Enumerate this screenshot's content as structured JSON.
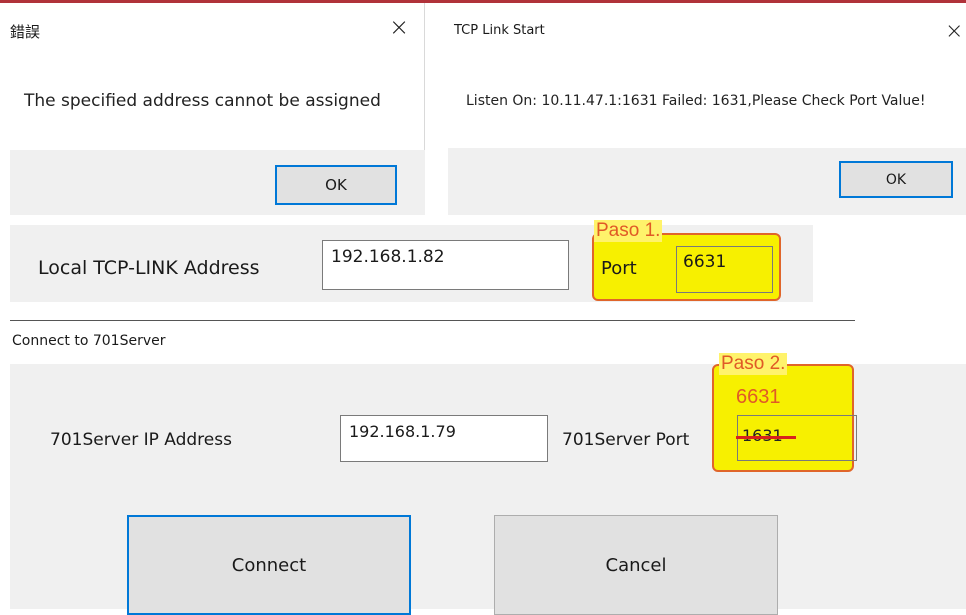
{
  "error_dialog": {
    "title": "錯誤",
    "message": "The specified address cannot be assigned",
    "ok_label": "OK",
    "close_icon": "×"
  },
  "tcp_dialog": {
    "title": "TCP Link Start",
    "message": "Listen On: 10.11.47.1:1631 Failed: 1631,Please Check Port Value!",
    "ok_label": "OK",
    "close_icon": "×"
  },
  "local": {
    "label": "Local TCP-LINK Address",
    "ip_value": "192.168.1.82",
    "port_label": "Port",
    "port_value": "6631",
    "step_label": "Paso 1."
  },
  "connect": {
    "title": "Connect to 701Server",
    "ip_label": "701Server IP Address",
    "ip_value": "192.168.1.79",
    "port_label": "701Server Port",
    "old_port_value": "1631",
    "new_port_value": "6631",
    "step_label": "Paso 2.",
    "connect_label": "Connect",
    "cancel_label": "Cancel"
  },
  "colors": {
    "accent": "#0078d7",
    "highlight": "#f7f000",
    "annotation": "#e05a26",
    "strike": "#d8221c"
  }
}
